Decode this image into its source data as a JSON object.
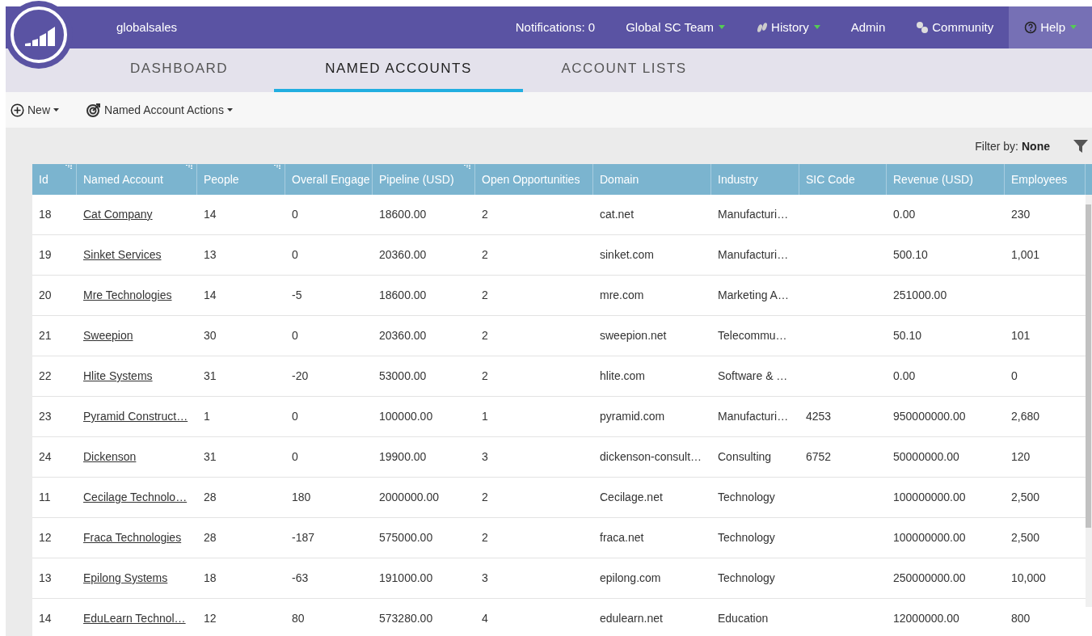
{
  "header": {
    "instance": "globalsales",
    "nav": [
      {
        "label": "Notifications: 0",
        "dropdown": false,
        "selected": false
      },
      {
        "label": "Global SC Team",
        "dropdown": true,
        "selected": false
      },
      {
        "label": "History",
        "dropdown": true,
        "selected": false
      },
      {
        "label": "Admin",
        "dropdown": false,
        "selected": false
      },
      {
        "label": "Community",
        "dropdown": false,
        "selected": false
      },
      {
        "label": "Help",
        "dropdown": true,
        "selected": true
      }
    ]
  },
  "tabs": [
    {
      "label": "DASHBOARD",
      "selected": false
    },
    {
      "label": "NAMED ACCOUNTS",
      "selected": true
    },
    {
      "label": "ACCOUNT LISTS",
      "selected": false
    }
  ],
  "toolbar": [
    {
      "label": "New"
    },
    {
      "label": "Named Account Actions"
    }
  ],
  "filter": {
    "label": "Filter by:",
    "value": "None"
  },
  "table": {
    "columns": [
      {
        "label": "Id",
        "resizable": true
      },
      {
        "label": "Named Account",
        "resizable": true
      },
      {
        "label": "People",
        "resizable": true
      },
      {
        "label": "Overall Engage",
        "resizable": false
      },
      {
        "label": "Pipeline (USD)",
        "resizable": true
      },
      {
        "label": "Open Opportunities",
        "resizable": false
      },
      {
        "label": "Domain",
        "resizable": false
      },
      {
        "label": "Industry",
        "resizable": false
      },
      {
        "label": "SIC Code",
        "resizable": false
      },
      {
        "label": "Revenue (USD)",
        "resizable": false
      },
      {
        "label": "Employees",
        "resizable": false
      }
    ],
    "rows": [
      [
        "18",
        "Cat Company",
        "14",
        "0",
        "18600.00",
        "2",
        "cat.net",
        "Manufacturi…",
        "",
        "0.00",
        "230"
      ],
      [
        "19",
        "Sinket Services",
        "13",
        "0",
        "20360.00",
        "2",
        "sinket.com",
        "Manufacturi…",
        "",
        "500.10",
        "1,001"
      ],
      [
        "20",
        "Mre Technologies",
        "14",
        "-5",
        "18600.00",
        "2",
        "mre.com",
        "Marketing A…",
        "",
        "251000.00",
        ""
      ],
      [
        "21",
        "Sweepion",
        "30",
        "0",
        "20360.00",
        "2",
        "sweepion.net",
        "Telecommu…",
        "",
        "50.10",
        "101"
      ],
      [
        "22",
        "Hlite Systems",
        "31",
        "-20",
        "53000.00",
        "2",
        "hlite.com",
        "Software & …",
        "",
        "0.00",
        "0"
      ],
      [
        "23",
        "Pyramid Construct…",
        "1",
        "0",
        "100000.00",
        "1",
        "pyramid.com",
        "Manufacturi…",
        "4253",
        "950000000.00",
        "2,680"
      ],
      [
        "24",
        "Dickenson",
        "31",
        "0",
        "19900.00",
        "3",
        "dickenson-consult…",
        "Consulting",
        "6752",
        "50000000.00",
        "120"
      ],
      [
        "11",
        "Cecilage Technolo…",
        "28",
        "180",
        "2000000.00",
        "2",
        "Cecilage.net",
        "Technology",
        "",
        "100000000.00",
        "2,500"
      ],
      [
        "12",
        "Fraca Technologies",
        "28",
        "-187",
        "575000.00",
        "2",
        "fraca.net",
        "Technology",
        "",
        "100000000.00",
        "2,500"
      ],
      [
        "13",
        "Epilong Systems",
        "18",
        "-63",
        "191000.00",
        "3",
        "epilong.com",
        "Technology",
        "",
        "250000000.00",
        "10,000"
      ],
      [
        "14",
        "EduLearn Technol…",
        "12",
        "80",
        "573280.00",
        "4",
        "edulearn.net",
        "Education",
        "",
        "12000000.00",
        "800"
      ]
    ]
  }
}
